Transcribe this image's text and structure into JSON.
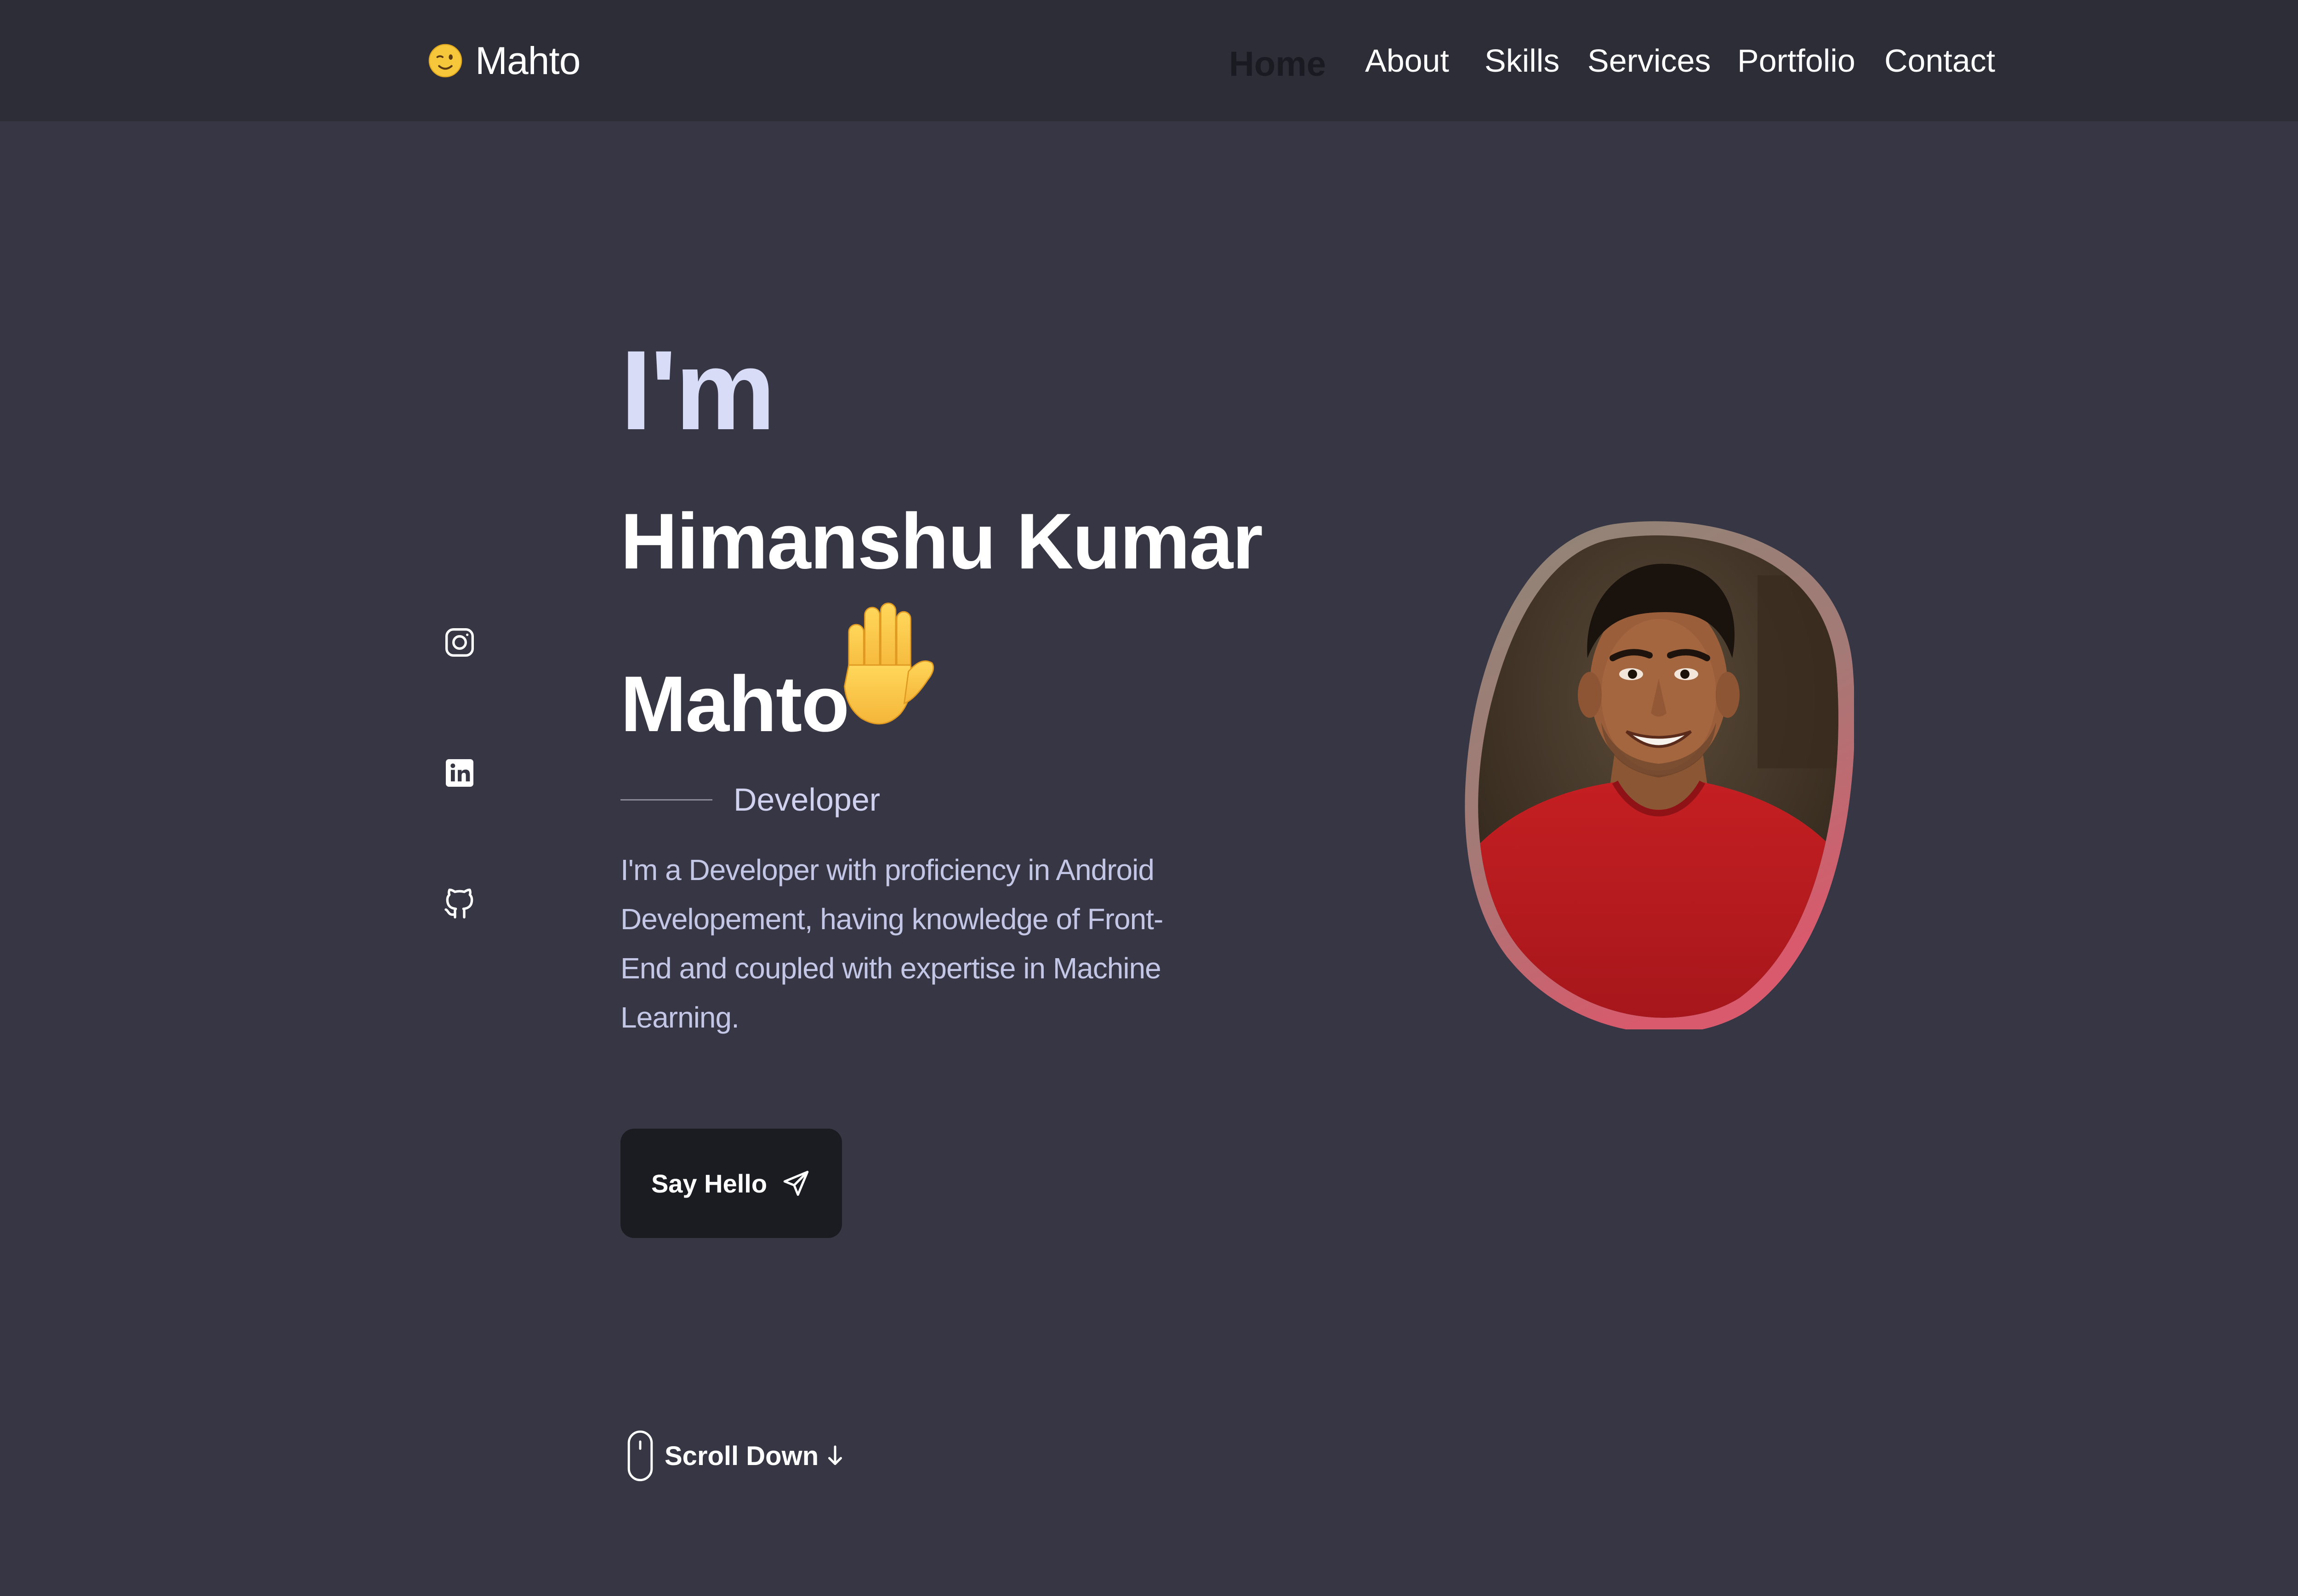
{
  "header": {
    "logo_text": "Mahto",
    "logo_icon": "winking-face-emoji"
  },
  "nav": {
    "items": [
      {
        "label": "Home",
        "active": true
      },
      {
        "label": "About",
        "active": false
      },
      {
        "label": "Skills",
        "active": false
      },
      {
        "label": "Services",
        "active": false
      },
      {
        "label": "Portfolio",
        "active": false
      },
      {
        "label": "Contact",
        "active": false
      }
    ]
  },
  "social": {
    "links": [
      {
        "icon": "instagram-icon"
      },
      {
        "icon": "linkedin-icon"
      },
      {
        "icon": "github-icon"
      }
    ]
  },
  "hero": {
    "greeting": "I'm",
    "name_line1": "Himanshu Kumar",
    "name_line2": "Mahto",
    "wave_icon": "raised-hand-emoji",
    "role": "Developer",
    "description": "I'm a Developer with proficiency in Android Developement, having knowledge of Front-End and coupled with expertise in Machine Learning.",
    "cta_label": "Say Hello",
    "cta_icon": "send-icon",
    "scroll_label": "Scroll Down",
    "scroll_icons": [
      "mouse-icon",
      "arrow-down-icon"
    ]
  },
  "profile": {
    "image": "profile-photo",
    "border_gradient": [
      "#8a8172",
      "#d35c6e"
    ]
  },
  "colors": {
    "background": "#363645",
    "header_bg": "#2d2d38",
    "accent_text": "#d9dcf6",
    "button_bg": "#1b1b22"
  }
}
